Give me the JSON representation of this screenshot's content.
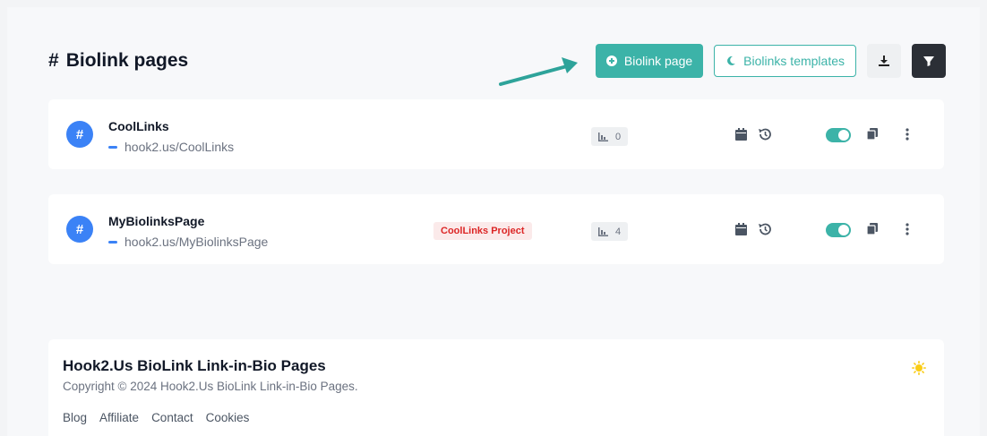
{
  "header": {
    "title_hash": "#",
    "title": "Biolink pages",
    "create_button": "Biolink page",
    "templates_button": "Biolinks templates"
  },
  "links": [
    {
      "name": "CoolLinks",
      "url": "hook2.us/CoolLinks",
      "project": "",
      "clicks": "0",
      "enabled": true
    },
    {
      "name": "MyBiolinksPage",
      "url": "hook2.us/MyBiolinksPage",
      "project": "CoolLinks Project",
      "clicks": "4",
      "enabled": true
    }
  ],
  "footer": {
    "title": "Hook2.Us BioLink Link-in-Bio Pages",
    "copyright": "Copyright © 2024 Hook2.Us BioLink Link-in-Bio Pages.",
    "links": [
      "Blog",
      "Affiliate",
      "Contact",
      "Cookies"
    ]
  },
  "colors": {
    "accent": "#3cb3a8",
    "avatar": "#3b82f6",
    "badge_text": "#dc2626",
    "dark_button": "#2b2f36",
    "annotation_arrow": "#2ea39a"
  },
  "icons": {
    "create": "plus-circle-icon",
    "templates": "moon-icon",
    "export": "download-icon",
    "filter": "filter-icon",
    "avatar": "hash-icon",
    "stats": "bar-chart-icon",
    "date": "calendar-icon",
    "history": "history-icon",
    "duplicate": "copy-icon",
    "menu": "more-vertical-icon",
    "theme": "sun-icon"
  }
}
